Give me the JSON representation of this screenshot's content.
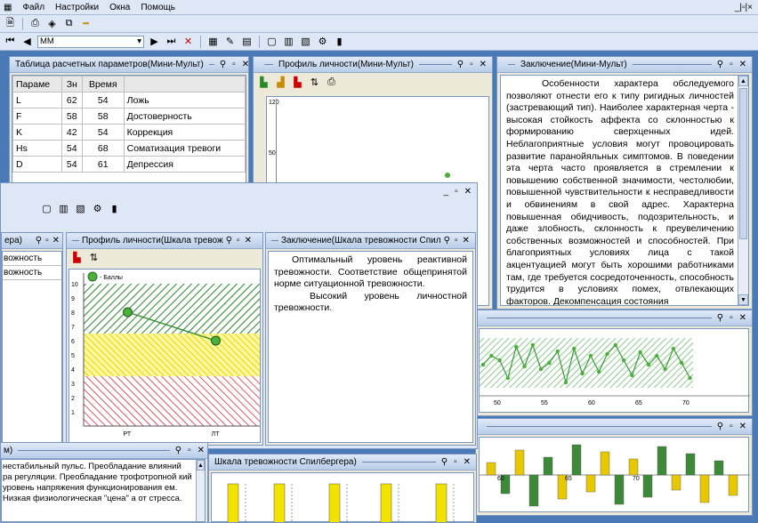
{
  "menu": {
    "file": "Файл",
    "settings": "Настройки",
    "windows": "Окна",
    "help": "Помощь",
    "sys_controls": "_|▫|×"
  },
  "nav": {
    "combo_value": "ММ"
  },
  "back_window": {
    "table_title": "Таблица расчетных параметров(Мини-Мульт)",
    "columns": [
      "Параме",
      "Зн",
      "Время",
      ""
    ],
    "rows": [
      [
        "L",
        "62",
        "54",
        "Ложь"
      ],
      [
        "F",
        "58",
        "58",
        "Достоверность"
      ],
      [
        "K",
        "42",
        "54",
        "Коррекция"
      ],
      [
        "Hs",
        "54",
        "68",
        "Соматизация тревоги"
      ],
      [
        "D",
        "54",
        "61",
        "Депрессия"
      ]
    ],
    "profile_title": "Профиль личности(Мини-Мульт)",
    "y_top": "120",
    "y_mid": "50",
    "conclusion_title": "Заключение(Мини-Мульт)",
    "conclusion_text": "Особенности характера обследуемого позволяют отнести его к типу ригидных личностей (застревающий тип). Наиболее характерная черта - высокая стойкость аффекта со склонностью к формированию сверхценных идей. Неблагоприятные условия могут провоцировать развитие паранойяльных симптомов. В поведении эта черта часто проявляется в стремлении к повышению собственной значимости, честолюбии, повышенной чувствительности к несправедливости и обвинениям в свой адрес. Характерна повышенная обидчивость, подозрительность, и даже злобность, склонность к преувеличению собственных возможностей и способностей. При благоприятных условиях лица с такой акцентуацией могут быть хорошими работниками там, где требуется сосредоточенность, способность трудится в условиях помех, отвлекающих факторов. Декомпенсация состояния",
    "line_ticks": [
      "50",
      "55",
      "60",
      "65",
      "70"
    ],
    "bar_ticks": [
      "60",
      "65",
      "70"
    ]
  },
  "front_window": {
    "left_title": "ера)",
    "left_rows": [
      "вожность",
      "вожность"
    ],
    "profile_title": "Профиль личности(Шкала тревож",
    "legend": "- Баллы",
    "y_ticks": [
      "10",
      "9",
      "8",
      "7",
      "6",
      "5",
      "4",
      "3",
      "2",
      "1"
    ],
    "x_labels": [
      "РТ",
      "ЛТ"
    ],
    "chart_data": {
      "type": "line",
      "categories": [
        "РТ",
        "ЛТ"
      ],
      "series": [
        {
          "name": "Баллы",
          "values": [
            8,
            6
          ]
        }
      ],
      "ylim": [
        0,
        10
      ],
      "zones": [
        {
          "from": 6.5,
          "to": 10,
          "color": "#3a8a3a"
        },
        {
          "from": 3.5,
          "to": 6.5,
          "color": "#e5d800"
        },
        {
          "from": 0,
          "to": 3.5,
          "color": "#c83040"
        }
      ]
    },
    "conclusion_title": "Заключение(Шкала тревожности Спил",
    "conclusion_p1": "Оптимальный уровень реактивной тревожности. Соответствие общепринятой норме ситуационной тревожности.",
    "conclusion_p2": "Высокий уровень личностной тревожности."
  },
  "bottom_left": {
    "title": "м)",
    "text": "нестабильный пульс. Преобладание влияний ра регуляции. Преобладание трофотропной кий уровень напряжения функционирования ем. Низкая физиологическая \"цена\" а от стресса."
  },
  "bottom_mid": {
    "title": "Шкала тревожности Спилбергера)"
  }
}
